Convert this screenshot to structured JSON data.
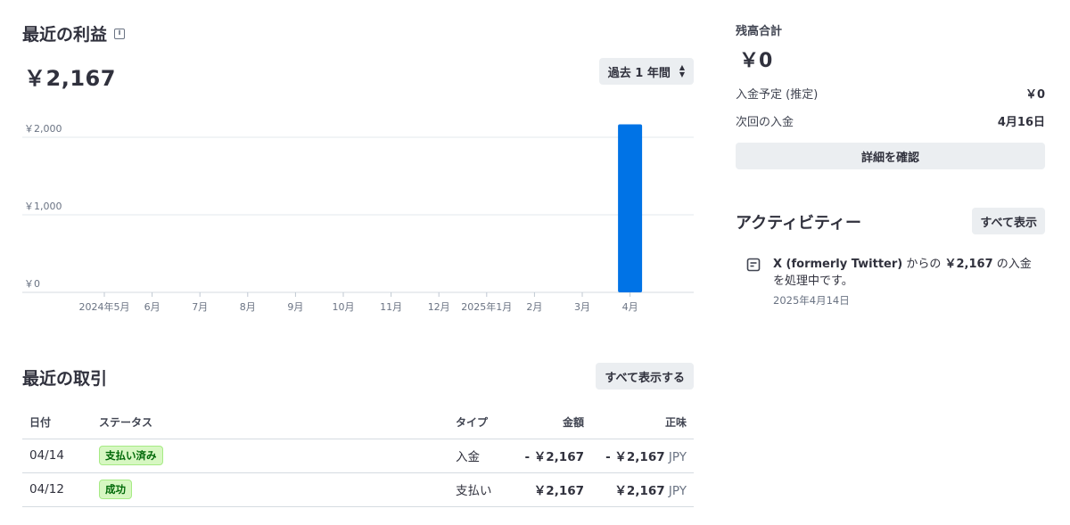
{
  "earnings": {
    "title": "最近の利益",
    "amount": "￥2,167",
    "period": "過去 1 年間"
  },
  "chart_data": {
    "type": "bar",
    "categories": [
      "2024年5月",
      "6月",
      "7月",
      "8月",
      "9月",
      "10月",
      "11月",
      "12月",
      "2025年1月",
      "2月",
      "3月",
      "4月"
    ],
    "values": [
      0,
      0,
      0,
      0,
      0,
      0,
      0,
      0,
      0,
      0,
      0,
      2167
    ],
    "ylim": [
      0,
      2000
    ],
    "yticks": [
      "￥2,000",
      "￥1,000",
      "￥0"
    ],
    "ytick_values": [
      2000,
      1000,
      0
    ],
    "color": "#0073e6",
    "grid": true
  },
  "transactions": {
    "title": "最近の取引",
    "show_all": "すべて表示する",
    "columns": [
      "日付",
      "ステータス",
      "タイプ",
      "金額",
      "正味"
    ],
    "rows": [
      {
        "date": "04/14",
        "status": "支払い済み",
        "type": "入金",
        "amount": "- ￥2,167",
        "net": "- ￥2,167",
        "currency": "JPY"
      },
      {
        "date": "04/12",
        "status": "成功",
        "type": "支払い",
        "amount": "￥2,167",
        "net": "￥2,167",
        "currency": "JPY"
      }
    ]
  },
  "balance": {
    "label": "残高合計",
    "amount": "￥0",
    "expected_label": "入金予定 (推定)",
    "expected_value": "￥0",
    "next_label": "次回の入金",
    "next_value": "4月16日",
    "details_button": "詳細を確認"
  },
  "activity": {
    "title": "アクティビティー",
    "show_all": "すべて表示",
    "items": [
      {
        "source": "X (formerly Twitter)",
        "text_a": " からの ",
        "amount": "￥2,167",
        "text_b": " の入金を処理中です。",
        "date": "2025年4月14日"
      }
    ]
  },
  "colors": {
    "accent_bar": "#0073e6",
    "badge_bg": "#d7f7c2",
    "badge_text": "#006908",
    "button_bg": "#ebeef1"
  }
}
